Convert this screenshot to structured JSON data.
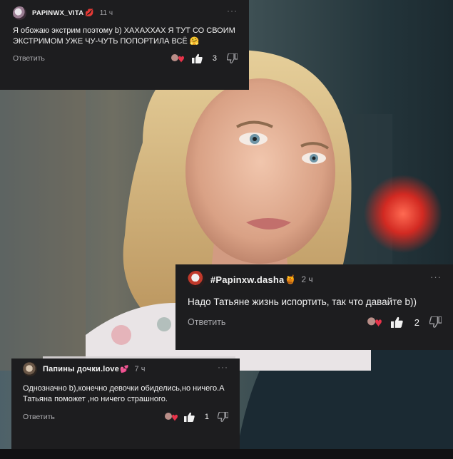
{
  "comments": [
    {
      "username": "PAPINWX_VITA",
      "username_suffix": "💋",
      "time": "11 ч",
      "text": "Я обожаю экстрим поэтому b) ХАХАХХАХ Я ТУТ СО СВОИМ ЭКСТРИМОМ УЖЕ ЧУ-ЧУТЬ ПОПОРТИЛА ВСЁ 🤗",
      "reply_label": "Ответить",
      "like_count": "3",
      "more_label": "···"
    },
    {
      "username": "#Papinxw.dasha",
      "username_suffix": "🍯",
      "time": "2 ч",
      "text": "Надо Татьяне жизнь испортить, так что давайте b))",
      "reply_label": "Ответить",
      "like_count": "2",
      "more_label": "···"
    },
    {
      "username": "Папины дочки.love",
      "username_suffix": "💕",
      "time": "7 ч",
      "text": "Однозначно b),конечно девочки обиделись,но ничего.А Татьяна поможет ,но ничего страшного.",
      "reply_label": "Ответить",
      "like_count": "1",
      "more_label": "···"
    }
  ],
  "icons": {
    "like": "thumbs-up-icon",
    "dislike": "thumbs-down-icon",
    "more": "more-dots-icon",
    "author_liked": "author-liked-heart-icon"
  },
  "colors": {
    "card_bg": "#1d1d1f",
    "text": "#f2f2f2",
    "muted": "#a4a4a8",
    "heart": "#e8334a"
  }
}
